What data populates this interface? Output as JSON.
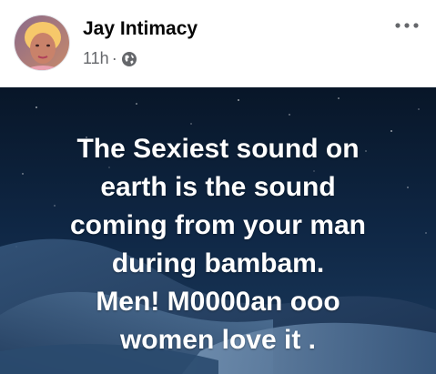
{
  "post": {
    "author": "Jay Intimacy",
    "time": "11h",
    "separator": "·",
    "audience_icon": "globe-icon",
    "menu_icon": "more-options-icon",
    "lines": [
      "The Sexiest sound on",
      "earth is the sound",
      "coming from your man",
      "during bambam.",
      "Men! M0000an ooo",
      "women love it ."
    ]
  },
  "colors": {
    "author": "#050505",
    "meta": "#65676b",
    "background_top": "#0b1a30",
    "background_bottom": "#4a6b8c",
    "text": "#ffffff"
  }
}
